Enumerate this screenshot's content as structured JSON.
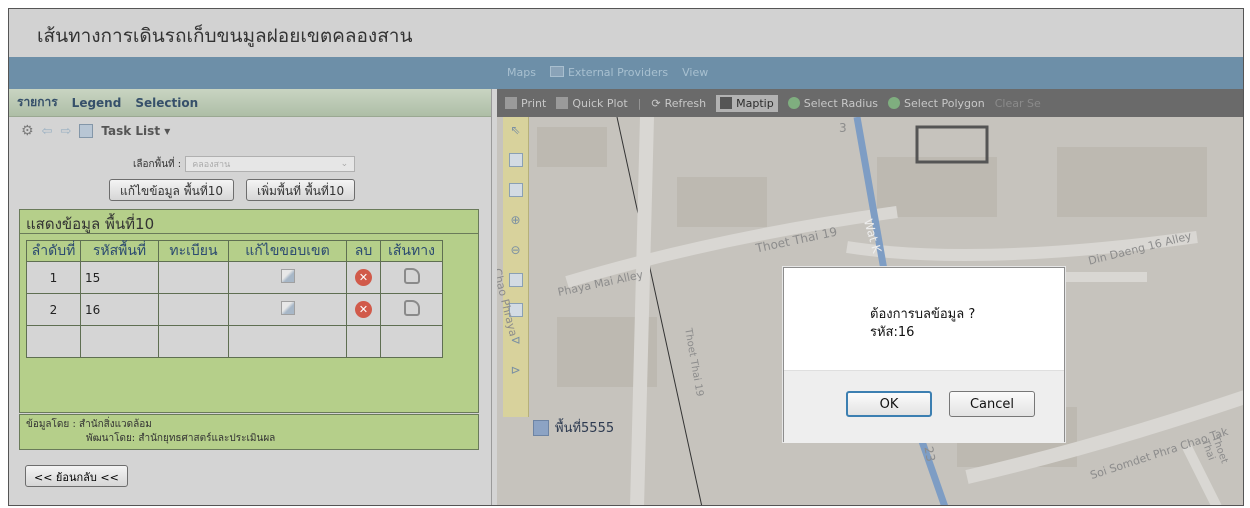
{
  "app": {
    "title": "เส้นทางการเดินรถเก็บขนมูลฝอยเขตคลองสาน"
  },
  "top_menu": {
    "items": [
      "Maps",
      "External Providers",
      "View"
    ]
  },
  "left_panel": {
    "tabs": [
      "รายการ",
      "Legend",
      "Selection"
    ],
    "task_list_label": "Task List ▾",
    "district_label": "เลือกพื้นที่ :",
    "district_value": "คลองสาน",
    "edit_area_button": "แก้ไขข้อมูล พื้นที่10",
    "add_area_button": "เพิ่มพื้นที่ พื้นที่10",
    "show_area_title": "แสดงข้อมูล พื้นที่10",
    "table": {
      "headers": [
        "ลำดับที่",
        "รหัสพื้นที่",
        "ทะเบียน",
        "แก้ไขขอบเขต",
        "ลบ",
        "เส้นทาง"
      ],
      "rows": [
        {
          "no": "1",
          "code": "15",
          "plate": ""
        },
        {
          "no": "2",
          "code": "16",
          "plate": ""
        }
      ]
    },
    "credit_line1": "ข้อมูลโดย : สำนักสิ่งแวดล้อม",
    "credit_line2": "พัฒนาโดย: สำนักยุทธศาสตร์และประเมินผล",
    "back_button": "<< ย้อนกลับ <<"
  },
  "map_toolbar": {
    "print": "Print",
    "quick_plot": "Quick Plot",
    "refresh": "Refresh",
    "maptip": "Maptip",
    "select_radius": "Select Radius",
    "select_polygon": "Select Polygon",
    "clear_sel": "Clear Se"
  },
  "map": {
    "labels": {
      "thoet_thai_19": "Thoet Thai 19",
      "wat_k": "Wat K",
      "phaya_mai_alley": "Phaya Mai Alley",
      "chao_phraya": "Chao Phraya",
      "thoet_thai_19_v": "Thoet Thai 19",
      "din_daeng_16_alley": "Din Daeng 16 Alley",
      "soi_somdet": "Soi Somdet Phra Chao Tak",
      "thoet_thai_v": "Thoet Thai",
      "num_3": "3",
      "num_23": "23"
    },
    "poi_label": "พื้นที่5555"
  },
  "dialog": {
    "message": "ต้องการบลข้อมูล ?",
    "code": "รหัส:16",
    "ok": "OK",
    "cancel": "Cancel"
  }
}
